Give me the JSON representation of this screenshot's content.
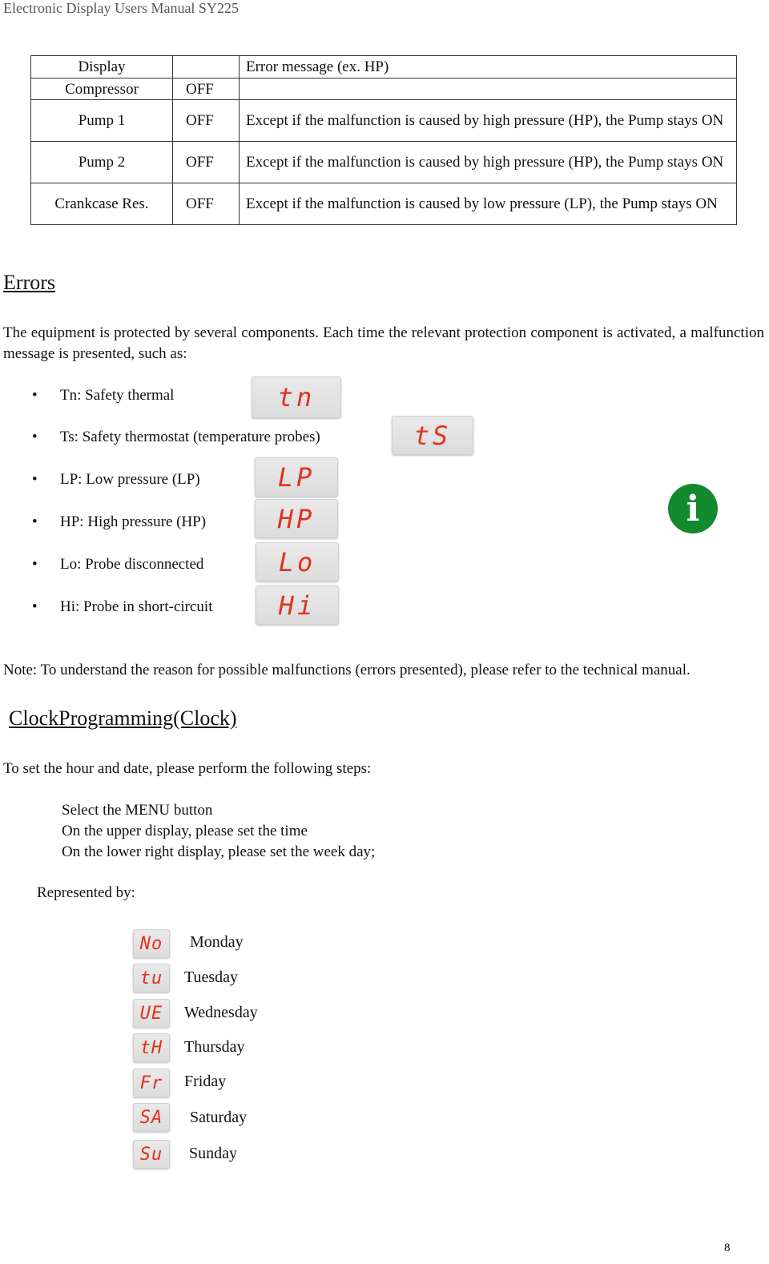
{
  "header": {
    "title": "Electronic Display Users Manual SY225"
  },
  "state_table": {
    "rows": [
      {
        "component": "Display",
        "state": "",
        "note": "Error message (ex. HP)"
      },
      {
        "component": "Compressor",
        "state": "OFF",
        "note": ""
      },
      {
        "component": "Pump 1",
        "state": "OFF",
        "note": "Except if the malfunction is caused by high pressure  (HP), the Pump stays ON"
      },
      {
        "component": "Pump 2",
        "state": "OFF",
        "note": "Except if the malfunction is caused by high pressure  (HP), the Pump stays ON"
      },
      {
        "component": "Crankcase Res.",
        "state": "OFF",
        "note": "Except if the malfunction is caused by low pressure  (LP), the Pump stays ON"
      }
    ]
  },
  "errors": {
    "heading": "Errors",
    "intro": "The equipment is protected by several components. Each time the relevant protection component is activated, a malfunction message is presented, such as:",
    "items": [
      {
        "text": "Tn: Safety thermal",
        "display": "tn"
      },
      {
        "text": "Ts: Safety thermostat (temperature probes)",
        "display": "tS"
      },
      {
        "text": "LP: Low pressure (LP)",
        "display": "LP"
      },
      {
        "text": "HP: High pressure (HP)",
        "display": "HP"
      },
      {
        "text": "Lo: Probe disconnected",
        "display": "Lo"
      },
      {
        "text": "Hi: Probe in short-circuit",
        "display": "Hi"
      }
    ],
    "bullet": "•",
    "info_icon": "i",
    "note": "Note: To understand the reason for possible malfunctions (errors presented), please refer to the technical manual."
  },
  "clock": {
    "heading": "ClockProgramming(Clock)",
    "intro": "To set the hour and date, please perform the following steps:",
    "steps": [
      "Select the MENU button",
      "On the upper display, please set the time",
      "On the lower right display, please set the week day;"
    ],
    "represented_by": "Represented by:",
    "days": [
      {
        "display": "No",
        "label": "Monday"
      },
      {
        "display": "tu",
        "label": "Tuesday"
      },
      {
        "display": "UE",
        "label": "Wednesday"
      },
      {
        "display": "tH",
        "label": "Thursday"
      },
      {
        "display": "Fr",
        "label": "Friday"
      },
      {
        "display": "SA",
        "label": "Saturday"
      },
      {
        "display": "Su",
        "label": "Sunday"
      }
    ]
  },
  "colors": {
    "lcd_text": "#e0321c",
    "info_green": "#138a2d"
  },
  "page_number": "8"
}
